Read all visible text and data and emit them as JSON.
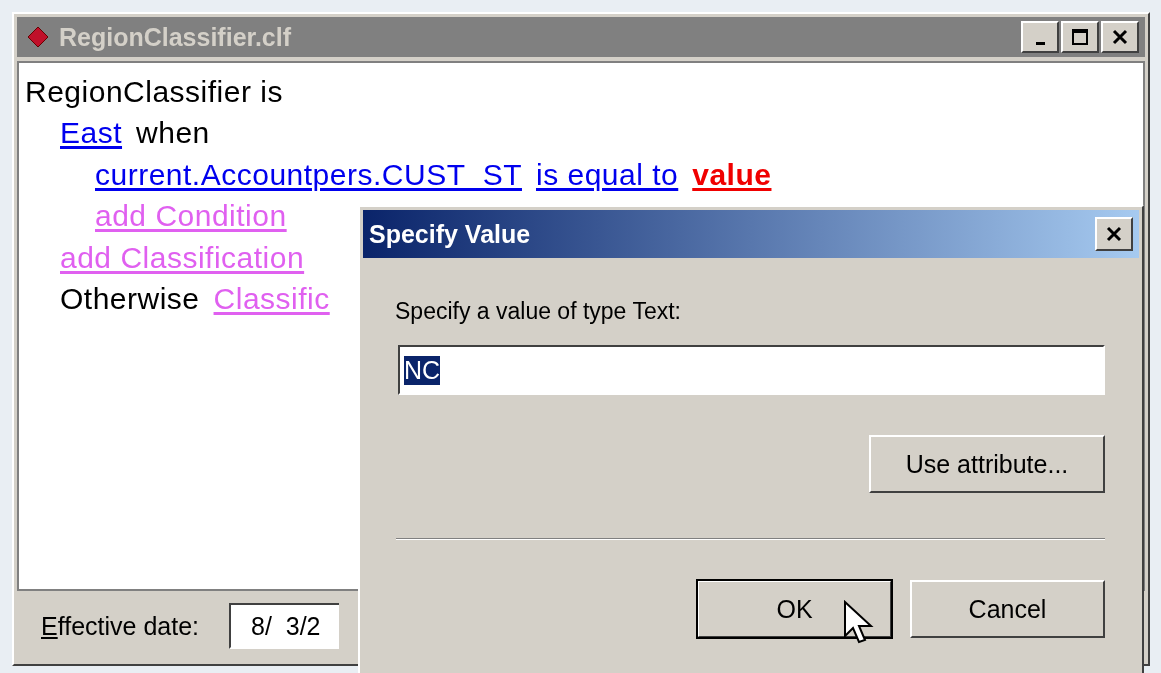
{
  "window": {
    "title": "RegionClassifier.clf"
  },
  "rules": [
    {
      "tokens": [
        {
          "kind": "text",
          "text": "RegionClassifier is"
        }
      ],
      "children": [
        {
          "tokens": [
            {
              "kind": "link",
              "text": "East"
            },
            {
              "kind": "text",
              "text": "when"
            }
          ],
          "children": [
            {
              "tokens": [
                {
                  "kind": "link",
                  "text": "current.Accountpers.CUST_ST"
                },
                {
                  "kind": "link",
                  "text": "is equal to"
                },
                {
                  "kind": "value",
                  "text": "value"
                }
              ]
            },
            {
              "tokens": [
                {
                  "kind": "add",
                  "text": "add Condition"
                }
              ]
            }
          ]
        },
        {
          "tokens": [
            {
              "kind": "add",
              "text": "add Classification"
            }
          ]
        },
        {
          "tokens": [
            {
              "kind": "text",
              "text": "Otherwise"
            },
            {
              "kind": "add",
              "text": "Classific"
            }
          ]
        }
      ]
    }
  ],
  "footer": {
    "label": "Effective date:",
    "date_value": "8/  3/2"
  },
  "dialog": {
    "title": "Specify Value",
    "prompt": "Specify a value of type Text:",
    "field": {
      "value": "NC",
      "text_selected": true
    },
    "attribute_button": "Use attribute...",
    "buttons": [
      {
        "label": "OK",
        "default": true
      },
      {
        "label": "Cancel",
        "default": false
      }
    ]
  }
}
